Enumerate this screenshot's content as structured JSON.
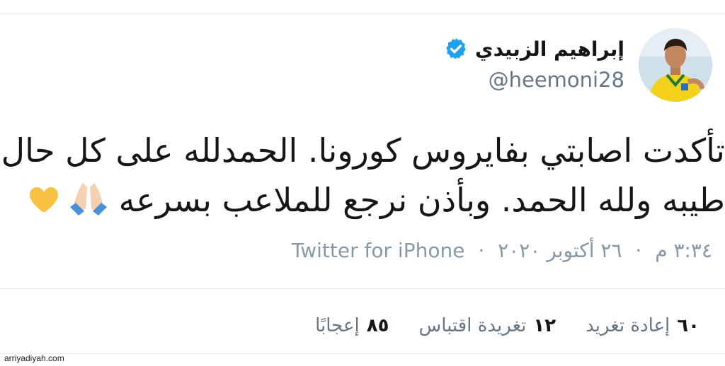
{
  "tweet": {
    "author_name": "إبراهيم الزبيدي",
    "handle": "@heemoni28",
    "text_line1": "تأكدت اصابتي بفايروس كورونا. الحمدلله على كل حال",
    "text_line2": "طيبه ولله الحمد. وبأذن نرجع للملاعب بسرعه",
    "time": "٣:٣٤ م",
    "date": "٢٦ أكتوبر ٢٠٢٠",
    "separator": "·",
    "source": "Twitter for iPhone"
  },
  "stats": {
    "retweets_count": "٦٠",
    "retweets_label": "إعادة تغريد",
    "quotes_count": "١٢",
    "quotes_label": "تغريدة اقتباس",
    "likes_count": "٨٥",
    "likes_label": "إعجابًا"
  },
  "icons": {
    "verified": "verified-badge-icon",
    "emoji_1": "folded-hands-emoji",
    "emoji_2": "yellow-heart-emoji"
  },
  "colors": {
    "verified_blue": "#1da1f2",
    "muted_text": "#657786",
    "meta_text": "#8899a6",
    "divider": "#e6ecf0"
  },
  "watermark": "arriyadiyah.com"
}
